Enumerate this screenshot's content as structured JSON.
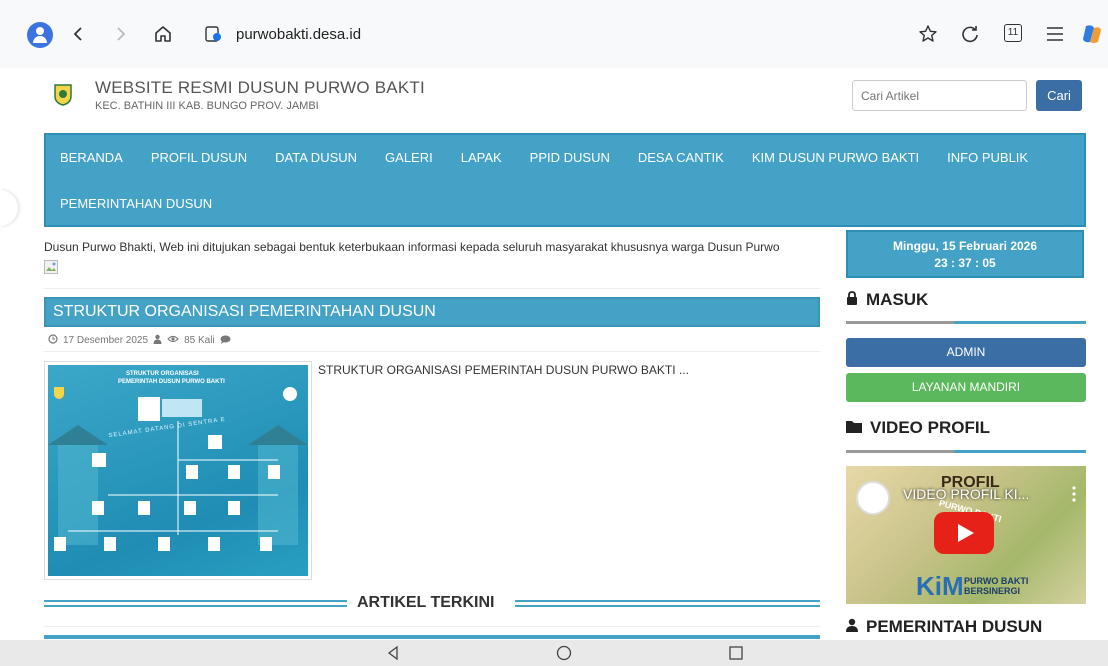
{
  "browser": {
    "url": "purwobakti.desa.id",
    "tab_count": "11"
  },
  "site": {
    "title": "WEBSITE RESMI DUSUN PURWO BAKTI",
    "subtitle": "KEC. BATHIN III KAB. BUNGO PROV. JAMBI",
    "search_placeholder": "Cari Artikel",
    "search_button": "Cari"
  },
  "nav": {
    "row1": [
      "BERANDA",
      "PROFIL DUSUN",
      "DATA DUSUN",
      "GALERI",
      "LAPAK",
      "PPID DUSUN",
      "DESA CANTIK",
      "KIM DUSUN PURWO BAKTI",
      "INFO PUBLIK"
    ],
    "row2": [
      "PEMERINTAHAN DUSUN"
    ]
  },
  "main": {
    "intro": "Dusun Purwo Bhakti, Web ini ditujukan sebagai bentuk keterbukaan informasi kepada seluruh masyarakat khususnya warga Dusun Purwo",
    "article": {
      "title": "STRUKTUR ORGANISASI PEMERINTAHAN DUSUN",
      "date": "17 Desember 2025",
      "views": "85 Kali",
      "excerpt": "STRUKTUR ORGANISASI PEMERINTAH DUSUN PURWO BAKTI ...",
      "image_heading_1": "STRUKTUR ORGANISASI",
      "image_heading_2": "PEMERINTAH DUSUN PURWO BAKTI",
      "image_banner": "SELAMAT DATANG DI SENTRA E"
    },
    "section_heading": "ARTIKEL TERKINI"
  },
  "sidebar": {
    "clock_date": "Minggu, 15 Februari 2026",
    "clock_time": "23 : 37 : 05",
    "login_heading": "MASUK",
    "admin_button": "ADMIN",
    "layanan_button": "LAYANAN MANDIRI",
    "video_heading": "VIDEO PROFIL",
    "video_title": "VIDEO PROFIL KI...",
    "video_overlay_top": "PROFIL",
    "video_overlay_arc": "PURWO BAKTI",
    "video_logo": "KiM",
    "video_logo_line1": "PURWO BAKTI",
    "video_logo_line2": "BERSINERGI",
    "gov_heading": "PEMERINTAH DUSUN"
  },
  "colors": {
    "nav_blue": "#44a2c7",
    "button_blue": "#3a6ea5",
    "button_green": "#5cb85c"
  }
}
